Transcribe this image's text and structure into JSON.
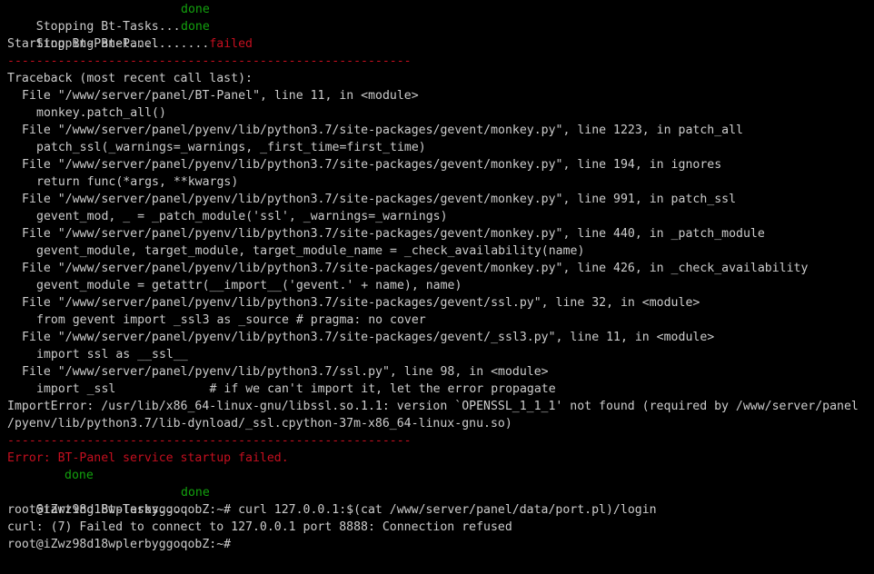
{
  "terminal": {
    "lines": {
      "stop_tasks": {
        "text": "Stopping Bt-Tasks...",
        "status": "done"
      },
      "stop_panel": {
        "text": "Stopping Bt-Panel...",
        "status": "done"
      },
      "start_panel": {
        "text": "Starting Bt-Panel...........",
        "status": "failed"
      },
      "divider1": "--------------------------------------------------------",
      "traceback_header": "Traceback (most recent call last):",
      "tb": [
        "File \"/www/server/panel/BT-Panel\", line 11, in <module>",
        "monkey.patch_all()",
        "File \"/www/server/panel/pyenv/lib/python3.7/site-packages/gevent/monkey.py\", line 1223, in patch_all",
        "patch_ssl(_warnings=_warnings, _first_time=first_time)",
        "File \"/www/server/panel/pyenv/lib/python3.7/site-packages/gevent/monkey.py\", line 194, in ignores",
        "return func(*args, **kwargs)",
        "File \"/www/server/panel/pyenv/lib/python3.7/site-packages/gevent/monkey.py\", line 991, in patch_ssl",
        "gevent_mod, _ = _patch_module('ssl', _warnings=_warnings)",
        "File \"/www/server/panel/pyenv/lib/python3.7/site-packages/gevent/monkey.py\", line 440, in _patch_module",
        "gevent_module, target_module, target_module_name = _check_availability(name)",
        "File \"/www/server/panel/pyenv/lib/python3.7/site-packages/gevent/monkey.py\", line 426, in _check_availability",
        "gevent_module = getattr(__import__('gevent.' + name), name)",
        "File \"/www/server/panel/pyenv/lib/python3.7/site-packages/gevent/ssl.py\", line 32, in <module>",
        "from gevent import _ssl3 as _source # pragma: no cover",
        "File \"/www/server/panel/pyenv/lib/python3.7/site-packages/gevent/_ssl3.py\", line 11, in <module>",
        "import ssl as __ssl__",
        "File \"/www/server/panel/pyenv/lib/python3.7/ssl.py\", line 98, in <module>",
        "import _ssl             # if we can't import it, let the error propagate"
      ],
      "import_error_1": "ImportError: /usr/lib/x86_64-linux-gnu/libssl.so.1.1: version `OPENSSL_1_1_1' not found (required by /www/server/panel",
      "import_error_2": "/pyenv/lib/python3.7/lib-dynload/_ssl.cpython-37m-x86_64-linux-gnu.so)",
      "divider2": "--------------------------------------------------------",
      "error_msg": "Error: BT-Panel service startup failed.",
      "done_indent": "done",
      "start_tasks": {
        "text": "Starting Bt-Tasks...",
        "status": "done"
      },
      "cmd1": {
        "prompt": "root@iZwz98d18wplerbyggoqobZ:~#",
        "command": " curl 127.0.0.1:$(cat /www/server/panel/data/port.pl)/login"
      },
      "curl_error": "curl: (7) Failed to connect to 127.0.0.1 port 8888: Connection refused",
      "cmd2": {
        "prompt": "root@iZwz98d18wplerbyggoqobZ:~#",
        "command": ""
      }
    }
  },
  "colors": {
    "background": "#000000",
    "text": "#cccccc",
    "success": "#13a10e",
    "error": "#c50f1f"
  }
}
